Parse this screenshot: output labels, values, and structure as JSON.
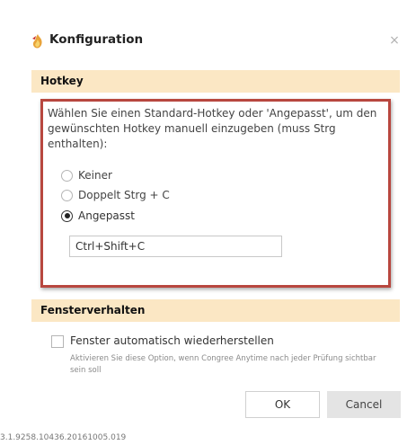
{
  "window": {
    "title": "Konfiguration",
    "close_glyph": "×",
    "icon": "flame-icon"
  },
  "hotkey_section": {
    "header": "Hotkey",
    "description": "Wählen Sie einen Standard-Hotkey oder 'Angepasst', um den gewünschten Hotkey manuell einzugeben (muss Strg enthalten):",
    "options": [
      {
        "label": "Keiner",
        "selected": false
      },
      {
        "label": "Doppelt Strg + C",
        "selected": false
      },
      {
        "label": "Angepasst",
        "selected": true
      }
    ],
    "custom_value": "Ctrl+Shift+C"
  },
  "window_section": {
    "header": "Fensterverhalten",
    "checkbox_label": "Fenster automatisch wiederherstellen",
    "checkbox_checked": false,
    "help_text": "Aktivieren Sie diese Option, wenn Congree Anytime nach jeder Prüfung sichtbar sein soll"
  },
  "buttons": {
    "ok": "OK",
    "cancel": "Cancel"
  },
  "version": "3.1.9258.10436.20161005.019",
  "colors": {
    "section_header_bg": "#fbe7c4",
    "highlight_border": "#b8473f",
    "cancel_bg": "#e4e4e4"
  }
}
